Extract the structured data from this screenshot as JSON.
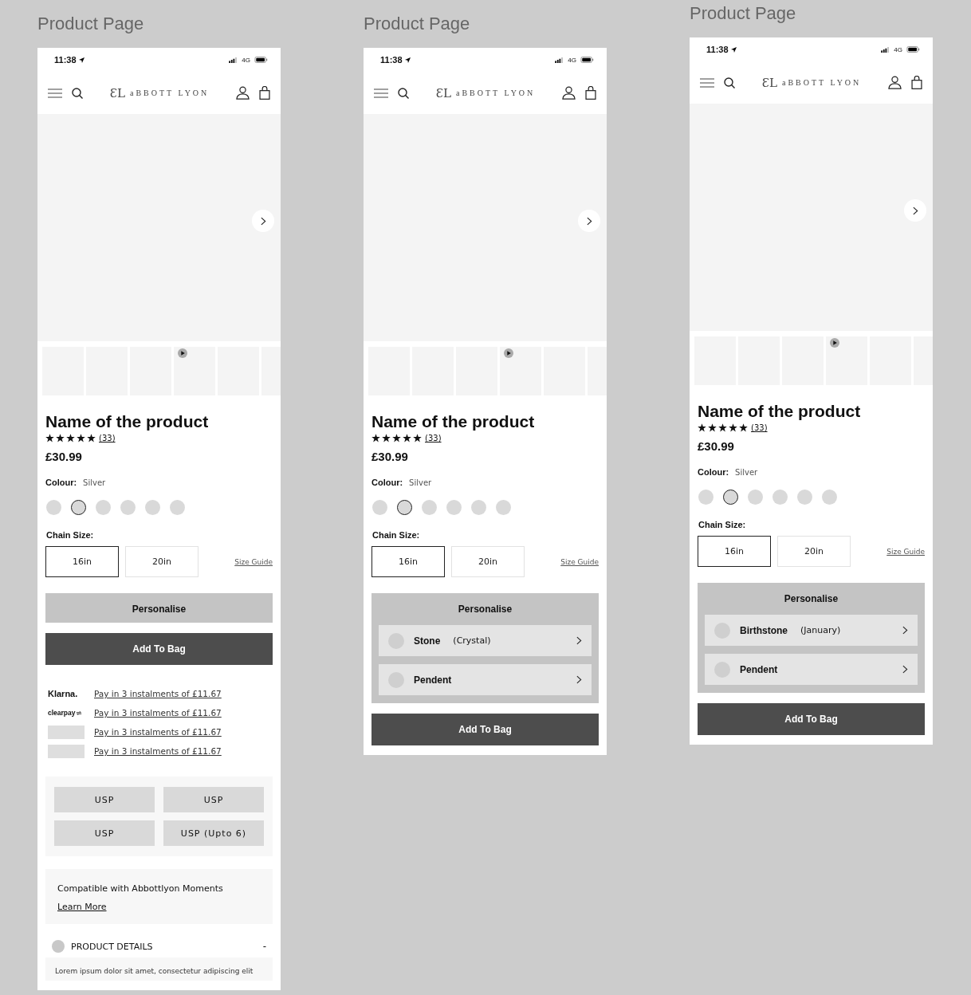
{
  "frames": [
    {
      "title": "Product Page",
      "status": {
        "time": "11:38",
        "network": "4G"
      },
      "monogram": "ƐL",
      "brand": "aBBOTT LYON",
      "thumbnails": [
        {
          "kind": "image"
        },
        {
          "kind": "image"
        },
        {
          "kind": "image"
        },
        {
          "kind": "video"
        },
        {
          "kind": "image"
        },
        {
          "kind": "image"
        }
      ],
      "product": {
        "name": "Name of the product",
        "stars": 5,
        "reviews": "(33)",
        "price": "£30.99"
      },
      "colour": {
        "label": "Colour:",
        "value": "Silver",
        "swatches": [
          {
            "selected": false
          },
          {
            "selected": true
          },
          {
            "selected": false
          },
          {
            "selected": false
          },
          {
            "selected": false
          },
          {
            "selected": false
          }
        ]
      },
      "chain": {
        "label": "Chain Size:",
        "sizes": [
          {
            "label": "16in",
            "selected": true
          },
          {
            "label": "20in",
            "selected": false
          }
        ],
        "guide": "Size Guide"
      },
      "personalise": {
        "label": "Personalise",
        "expanded": false
      },
      "add_to_bag": "Add To Bag",
      "payments": [
        {
          "kind": "klarna",
          "provider": "Klarna.",
          "text": "Pay in 3 instalments of £11.67"
        },
        {
          "kind": "clearpay",
          "provider": "clearpay",
          "text": "Pay in 3 instalments of £11.67"
        },
        {
          "kind": "placeholder",
          "text": "Pay in 3 instalments of £11.67"
        },
        {
          "kind": "placeholder",
          "text": "Pay in 3 instalments of £11.67"
        }
      ],
      "usps": [
        "USP",
        "USP",
        "USP",
        "USP (Upto 6)"
      ],
      "moments": {
        "text": "Compatible with Abbottlyon Moments",
        "link": "Learn More"
      },
      "details": {
        "title": "PRODUCT DETAILS",
        "toggle": "-",
        "body": "Lorem ipsum dolor sit amet, consectetur adipiscing elit"
      }
    },
    {
      "title": "Product Page",
      "status": {
        "time": "11:38",
        "network": "4G"
      },
      "monogram": "ƐL",
      "brand": "aBBOTT LYON",
      "thumbnails": [
        {
          "kind": "image"
        },
        {
          "kind": "image"
        },
        {
          "kind": "image"
        },
        {
          "kind": "video"
        },
        {
          "kind": "image"
        },
        {
          "kind": "image"
        }
      ],
      "product": {
        "name": "Name of the product",
        "stars": 5,
        "reviews": "(33)",
        "price": "£30.99"
      },
      "colour": {
        "label": "Colour:",
        "value": "Silver",
        "swatches": [
          {
            "selected": false
          },
          {
            "selected": true
          },
          {
            "selected": false
          },
          {
            "selected": false
          },
          {
            "selected": false
          },
          {
            "selected": false
          }
        ]
      },
      "chain": {
        "label": "Chain Size:",
        "sizes": [
          {
            "label": "16in",
            "selected": true
          },
          {
            "label": "20in",
            "selected": false
          }
        ],
        "guide": "Size Guide"
      },
      "personalise": {
        "label": "Personalise",
        "expanded": true,
        "options": [
          {
            "name": "Stone",
            "detail": "(Crystal)"
          },
          {
            "name": "Pendent"
          }
        ]
      },
      "add_to_bag": "Add To Bag"
    },
    {
      "title": "Product Page",
      "status": {
        "time": "11:38",
        "network": "4G"
      },
      "monogram": "ƐL",
      "brand": "aBBOTT LYON",
      "thumbnails": [
        {
          "kind": "image"
        },
        {
          "kind": "image"
        },
        {
          "kind": "image"
        },
        {
          "kind": "video"
        },
        {
          "kind": "image"
        },
        {
          "kind": "image"
        }
      ],
      "product": {
        "name": "Name of the product",
        "stars": 5,
        "reviews": "(33)",
        "price": "£30.99"
      },
      "colour": {
        "label": "Colour:",
        "value": "Silver",
        "swatches": [
          {
            "selected": false
          },
          {
            "selected": true
          },
          {
            "selected": false
          },
          {
            "selected": false
          },
          {
            "selected": false
          },
          {
            "selected": false
          }
        ]
      },
      "chain": {
        "label": "Chain Size:",
        "sizes": [
          {
            "label": "16in",
            "selected": true
          },
          {
            "label": "20in",
            "selected": false
          }
        ],
        "guide": "Size Guide"
      },
      "personalise": {
        "label": "Personalise",
        "expanded": true,
        "options": [
          {
            "name": "Birthstone",
            "detail": "(January)"
          },
          {
            "name": "Pendent"
          }
        ]
      },
      "add_to_bag": "Add To Bag"
    }
  ]
}
